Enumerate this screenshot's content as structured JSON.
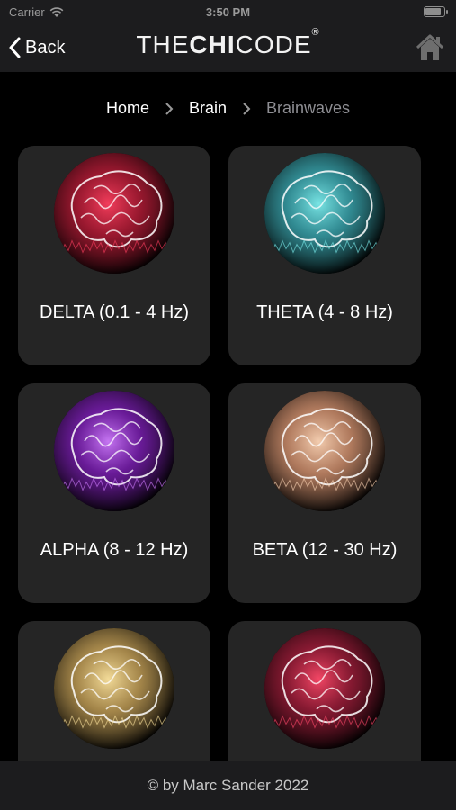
{
  "status_bar": {
    "carrier": "Carrier",
    "time": "3:50 PM",
    "battery_level": 0.9
  },
  "nav": {
    "back_label": "Back",
    "logo_prefix": "THE",
    "logo_bold": "CHI",
    "logo_suffix": "CODE",
    "logo_mark": "®",
    "home_icon": "home-icon"
  },
  "breadcrumb": {
    "items": [
      "Home",
      "Brain",
      "Brainwaves"
    ]
  },
  "cards": [
    {
      "label": "DELTA (0.1 - 4 Hz)",
      "color": "#c81e3c",
      "glow": "#ff4060"
    },
    {
      "label": "THETA (4 - 8 Hz)",
      "color": "#3fb6c0",
      "glow": "#7ff0f0"
    },
    {
      "label": "ALPHA (8 - 12 Hz)",
      "color": "#8a22c8",
      "glow": "#d07cff"
    },
    {
      "label": "BETA (12 - 30 Hz)",
      "color": "#e8a07a",
      "glow": "#ffd7b8"
    },
    {
      "label": "",
      "color": "#d8b060",
      "glow": "#ffe6a0"
    },
    {
      "label": "",
      "color": "#b02040",
      "glow": "#ff4a6a"
    }
  ],
  "footer": {
    "text": "© by Marc Sander 2022"
  }
}
